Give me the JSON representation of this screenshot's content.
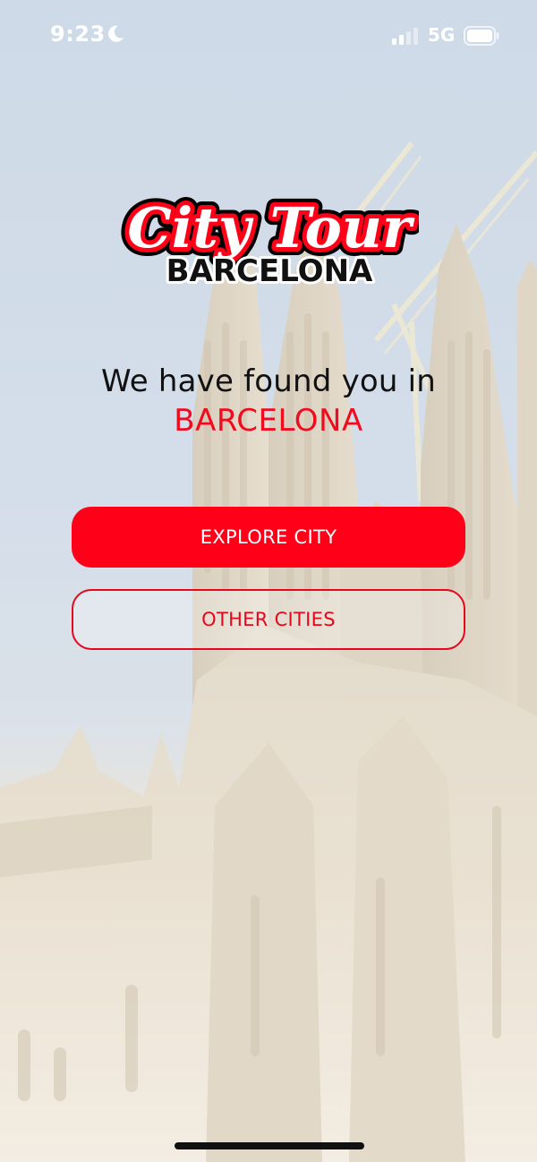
{
  "status_bar": {
    "time": "9:23",
    "network": "5G",
    "moon_icon": "moon-icon",
    "signal_icon": "cellular-signal-icon",
    "battery_icon": "battery-icon"
  },
  "logo": {
    "line1": "City Tour",
    "line2": "BARCELONA"
  },
  "main": {
    "headline": "We have found you in",
    "city": "BARCELONA"
  },
  "actions": {
    "primary_label": "EXPLORE CITY",
    "secondary_label": "OTHER CITIES"
  },
  "colors": {
    "brand_red": "#ff0019",
    "text_dark": "#111111"
  }
}
